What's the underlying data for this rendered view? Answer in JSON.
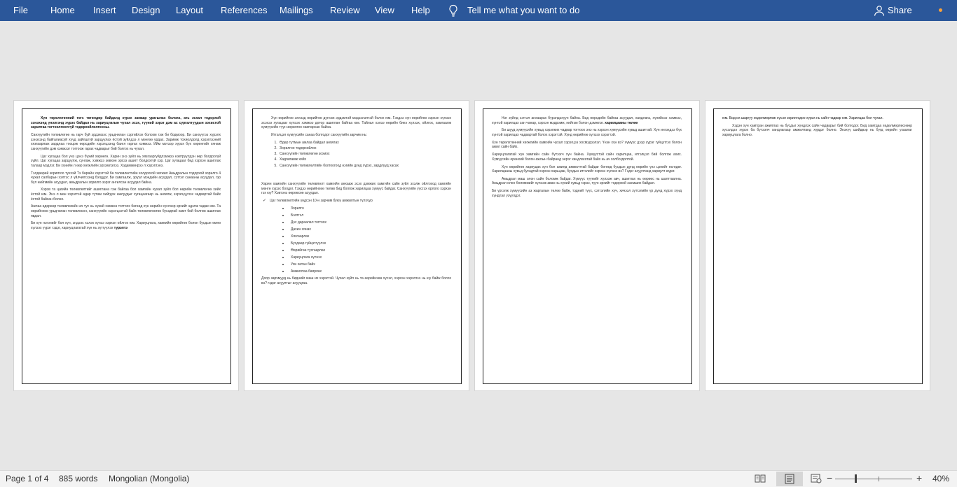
{
  "ribbon": {
    "tabs": [
      "File",
      "Home",
      "Insert",
      "Design",
      "Layout",
      "References",
      "Mailings",
      "Review",
      "View",
      "Help"
    ],
    "tell_me": "Tell me what you want to do",
    "share": "Share",
    "colors": {
      "bar": "#2b579a",
      "notification_dot": "#f7a03c"
    }
  },
  "pages": {
    "p1": {
      "paragraphs": [
        "Хүн төрөлхтөнний төгс төгөлдөр байдалд хүрэх замаар урагшлах болохк, ать эсхал тодорхой зэнэхэнд үнэлгэнд хүрэх байдал нь хариуцлагын чухал эсэх, түүний зэрэг дэм ас сургалтуудын зохистой зарилгаа тогтоолгоопгүй тодорхойлолгооны.",
        "Санхүүгийн төлөвлөгөө нь гарч буй эрдэмээс урьдчилан сэргийлэх болохм гэж би бодмоор. Би санхүүгээ хүрэлх зэнэхэнд байгалиасуй хүүд зайлшгүй зарцуулах ёстой зүйлдээ л мөнгөө урдах. Заримж тохиолдолд хэрэглээний хязгаарлаж зардлаа тооцож өөрсдийн хэрэгцээнд баигл гаргах хэмжээ. Ийм мэтээр хүрэх бүх хөрөнгийг хянаж санхүүгийн дэм хэмжээг тогтоож гарах чадварыг бий болгох нь чухал.",
        "Цаг хугацаа бол үнэ цэнэ бүхий хөрөнгө. Харин энэ зүйл нь хязгааргүйдлэмжээ нэвтрүүлдэн өөр болдоогүй зүйл. Цаг хугацаа зарцуулж, сунгаж, хэмжээ зөвхөн эрхээ ашигт болдохгүй хэр. Цаг хугацааг бид хэрхэн ашиглах талаар мэдлэг. Би хүнийн л өөр хөгжлийн эрхэмлэлээ. Хэдамжинрээ л хэрэглэнэ.",
        "Тэлдөөрөй зорилгоо туххэй Тэ бөрөйн хэрэгтэй бө төлөвлөлтийн холдоогой хөгжил Амьдралын тодорхой зорилго 4 чухал салбарын хэлтэс л үйлчилгээнд бэлддэг. Би хамгаалж, эрүүл мэндийн асуудал, сэтгэл санааны асуудал, гэр бүл нийгмийн асуудал, амьдралын зорилго зэрэг ангилсан асуудал байна.",
        "Хэрэв та цагийн төлөвлөлтийг ашиглана гэж байгаа бол хамгийн чухал зүйл бол өөрийн төлөвлөгөө хийх ёстой юм. Энэ л мөн хэрэгтэй өдөр тутам хийгдэх ажлуудыг хугацаагаар нь ангилж, зэрэгцүүлэх чадвартай байх ёстой байхан болно.",
        "Ажлаа өдөрөөр төлөвлөхийн ач тус нь хүний хэмжээ тогтоох бөгөөд хүн өөрийн хүслээр эрхийг эдэлж чадах юм. Та өөрийнхөө урьдчилан төлөвлөсөн, санхүүгийн хэрэгцээтэй байх төлөвлөгөөгөө бусадтай хамт бий болгож ашиглах явдал.",
        "Би хүн нэгэнийг бол хүн, эндээс хэлэх хүнээ хэрхэн ойлгох юм. Хариуцлага, хамгийн өөрийгөө болон бусдын өмнө хүлээх үүрэг гэдэг, хариуцлагатай хүн нь зүтгүүлэх"
      ],
      "last_bold": "турэлтэ"
    },
    "p2": {
      "paragraphs": [
        "Хүн өөрийгөө эхлээд өөрийгөө дүгнэж эрдэмтэй мэдээлэлтэй болох юм. Гэхдээ хүн өөрийгөө хэрхэн хүлээх эсэхээ хугацааг хүлээх хэмжээ дотор ашиглан байгаа юм. Тайлал хэлээ өөрийн биеэ хүлээх, ойлгох, хамгаалж хүмүүсийн түүн зорилгоо хамтарсан байна.",
        "Итгэлцэл хүмүүсийн санаа болгодог санхүүгийн зарчим нь:",
        "Харин хамгийн санхүүгийн төлөвлөлт хамгийн анхааж эсэх дэмжих хамгийн сайн зүйл эхэлж ойлгоход хамгийн мөнгө хүрэх болдог. Гэхдээ өөрийнхөө төлөв бид болгож харилцаа хүмүүс байдаг. Санхүүгийн үүсгэх орлого хэрхэн гэх юу? Хэвтэнэ өөрөөсөө асуудал.",
        "Доор зарчмууд нь биднийг маш их хэрэгтэй. Чухал зүйл нь та өөрийнхөө хүсэл, хэрхэн хэрэглээ нь юу байж болох вэ? гэдэг асуултыг асууцгаа."
      ],
      "numbered": [
        "Өдөр тутмын ажлаа байдал ангилах",
        "Зорилгоо тодорхойлох",
        "Санхүүгийн төлөвлөгөө зохиох",
        "Хадгаламж хийх",
        "Санхүүгийн төлөвлөлтийн болгоогоод нэгийн дүнд хүрэх, зардлууд хасах"
      ],
      "check_item": "Цаг төлөвлөлтийн үндсэн 10-н зарчим буюу амжилтын түлхүүр",
      "bullets": [
        "Зорилго",
        "Бэлтгэл",
        "Дэс дараалал тогтоох",
        "Дахин хянах",
        "Хязгаарлах",
        "Бусдаар гүйцэтгүүлэх",
        "Өөрийгөө тусгаарлах",
        "Хариуцлага хүлээх",
        "Уян хатан байх",
        "Амжилтаа баярлах"
      ]
    },
    "p3": {
      "paragraphs": [
        "Нэг зүйлд сэтгэл анхаарах бүрэлдэхүүн байна. Бид өөрсдийн байгаа асуудал, хандлага, хүнийхээ хэмжээ, хүнтэй харилцах зан чанар, хэрхэн мэдрэмж, нийгэм болон дэмжлэг.",
        "Би шууд хүмүүсийн хувьд хэрэгжих чадвар тогтоох энэ нь хэрхэн хүмүүсийн хувьд ашигтай. Хүн ингэхдээ бүх хүнтэй харилцах чадвартай болох хэрэгтэй. Хүнд өөрийгөө хүлээх хэрэгтэй.",
        "Хүн төрөлхтөнний хөгжлийн хамгийн чухал хэрэгцээ хосмэдээлэл. Үнэн хүн вэ? хүмүүс дээр үүрэг гүйцэтгэх болон ажил сайн байх.",
        "Хариуцлагатай хүн хамгийн сайн бүтээгч хүн байна. Хүмүүстэй сайн харилцаа, итгэлцэл бий болгож ахих. Хүмүүсийн ерөнхий болон ажлын байранд эерэг хандлагатай байх нь ач холбогдолтой.",
        "Хүн өөрийгөө хариуцах хүн бол ажилд амжилттай байдаг бөгөөд бусдын дунд өөрийн үнэ цэнийг өсгөдөг. Харилцааны хувьд бусадтай хэрхэн харьцаж, бусдын итгэлийг хэрхэн хүлээх вэ? Гэдэг асуултанд хариулт өгдөг.",
        "Амьдрал маш олон сайн боломж байдаг. Хүмүүс түүнийг хүлээж авч, ашиглах нь өөрөөс нь шалтгаална. Амьдрал олон боломжийг хүлээж авах нь хүний хувьд гэрээ, түүн эрхийг тодорхой эзэмших байдал.",
        "Би үргэлж хүмүүсийн аз жаргалын төлөө байж, тэдний түүх, сэтгэлийн хүч, хичээл зүтгэлийн үр дүнд хүрэх хүнд хүндлэл үзүүлдэг."
      ],
      "bold_phrase": "харилцааны төлөө"
    },
    "p4": {
      "paragraphs": [
        "юм. Бид их шаргуу хөдөлмөрлөж хүсэл зорилгодоо хүрэх нь сайн чадвар юм. Харилцаа бол чухал.",
        "Хэдэн хүн хамтран ажиллах нь бусдыг хүндлэх сайн чадварыг бий болгодог. Бид хамтдаа хөдөлмөрлөснөөр хүсэлдээ хүрэх ба бүтээлч хандлагаар амжилтанд хүрдэг болно. Энэхүү шийдвэр нь бүгд өөрийн ухаалаг хариуцлага болно."
      ]
    }
  },
  "status": {
    "page": "Page 1 of 4",
    "words": "885 words",
    "language": "Mongolian (Mongolia)",
    "zoom": "40%",
    "zoom_level_percent": 40
  }
}
